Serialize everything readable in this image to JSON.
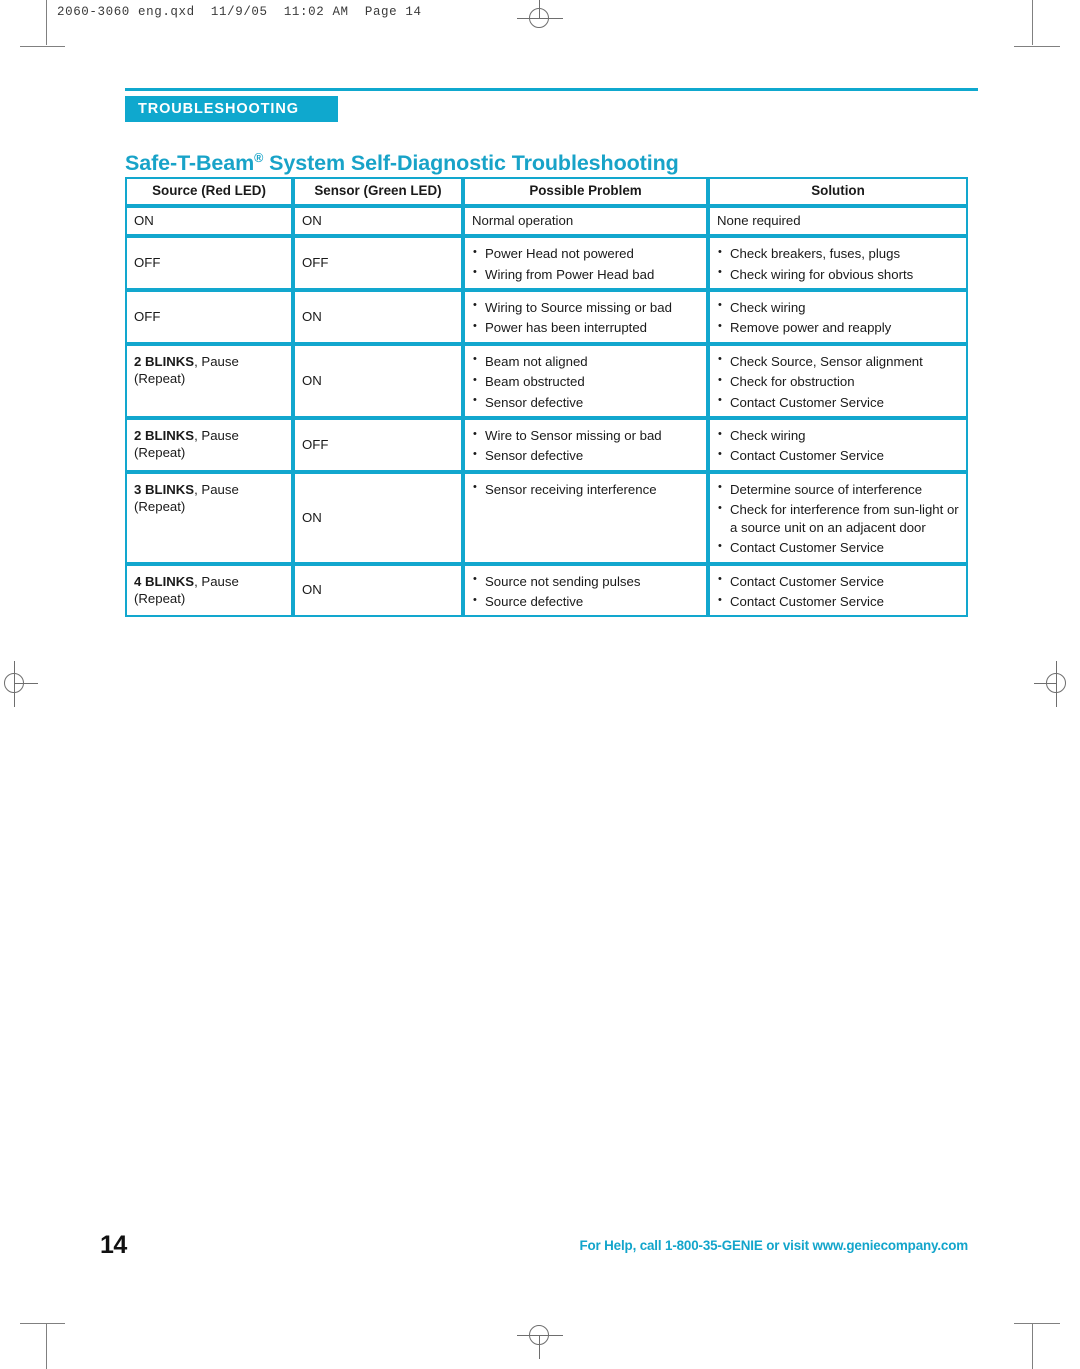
{
  "slug_line": "2060-3060 eng.qxd  11/9/05  11:02 AM  Page 14",
  "section_tab": "TROUBLESHOOTING",
  "title": {
    "brand": "Safe-T-Beam",
    "trademark": "®",
    "rest": " System Self-Diagnostic Troubleshooting"
  },
  "colors": {
    "accent_teal": "#0FA8CE",
    "title_teal": "#18A3C8",
    "table_border": "#12A7CE",
    "text": "#1a1a1a",
    "mark_gray": "#6e6e6e"
  },
  "table": {
    "headers": [
      "Source (Red LED)",
      "Sensor (Green LED)",
      "Possible Problem",
      "Solution"
    ],
    "rows": [
      {
        "source": "ON",
        "source_bold": "",
        "source_repeat": "",
        "sensor": "ON",
        "problems": [
          "Normal operation"
        ],
        "problems_bulleted": false,
        "solutions": [
          "None required"
        ],
        "solutions_bulleted": false
      },
      {
        "source": "OFF",
        "source_bold": "",
        "source_repeat": "",
        "sensor": "OFF",
        "problems": [
          "Power Head not powered",
          "Wiring from Power Head bad"
        ],
        "problems_bulleted": true,
        "solutions": [
          "Check breakers, fuses, plugs",
          "Check wiring for obvious shorts"
        ],
        "solutions_bulleted": true
      },
      {
        "source": "OFF",
        "source_bold": "",
        "source_repeat": "",
        "sensor": "ON",
        "problems": [
          "Wiring to Source missing or bad",
          "Power has been interrupted"
        ],
        "problems_bulleted": true,
        "solutions": [
          "Check wiring",
          "Remove power and reapply"
        ],
        "solutions_bulleted": true
      },
      {
        "source": ", Pause",
        "source_bold": "2 BLINKS",
        "source_repeat": "(Repeat)",
        "sensor": "ON",
        "problems": [
          "Beam not aligned",
          "Beam obstructed",
          "Sensor defective"
        ],
        "problems_bulleted": true,
        "solutions": [
          "Check Source, Sensor alignment",
          "Check for obstruction",
          "Contact Customer Service"
        ],
        "solutions_bulleted": true
      },
      {
        "source": ", Pause",
        "source_bold": "2 BLINKS",
        "source_repeat": "(Repeat)",
        "sensor": "OFF",
        "problems": [
          "Wire to Sensor missing or bad",
          "Sensor defective"
        ],
        "problems_bulleted": true,
        "solutions": [
          "Check wiring",
          "Contact Customer Service"
        ],
        "solutions_bulleted": true
      },
      {
        "source": ", Pause",
        "source_bold": "3 BLINKS",
        "source_repeat": "(Repeat)",
        "sensor": "ON",
        "problems": [
          "Sensor receiving interference"
        ],
        "problems_bulleted": true,
        "solutions": [
          "Determine source of interference",
          "Check for interference from sun-light or a source unit on an adjacent door",
          "Contact Customer Service"
        ],
        "solutions_bulleted": true
      },
      {
        "source": ", Pause",
        "source_bold": "4 BLINKS",
        "source_repeat": "(Repeat)",
        "sensor": "ON",
        "problems": [
          "Source not sending pulses",
          "Source defective"
        ],
        "problems_bulleted": true,
        "solutions": [
          "Contact Customer Service",
          "Contact Customer Service"
        ],
        "solutions_bulleted": true
      }
    ]
  },
  "footer": {
    "page_number": "14",
    "help_text": "For Help, call 1-800-35-GENIE or visit www.geniecompany.com"
  }
}
